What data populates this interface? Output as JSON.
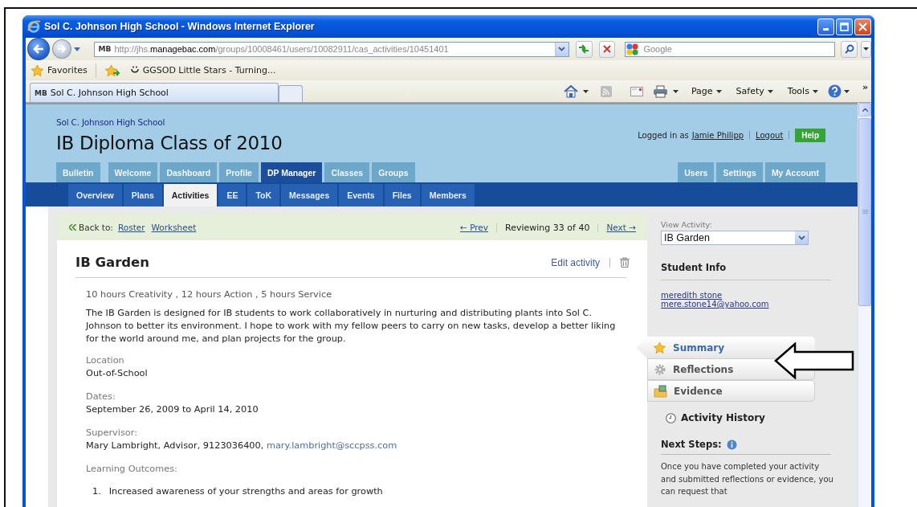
{
  "window": {
    "title": "Sol C. Johnson High School - Windows Internet Explorer"
  },
  "address_bar": {
    "site_icon": "MB",
    "url": "http://jhs.**managebac.com**/groups/10008461/users/10082911/cas_activities/10451401"
  },
  "search_box": {
    "placeholder": "Google"
  },
  "favorites_bar": {
    "label": "Favorites",
    "links": [
      {
        "label": "GGSOD Little Stars - Turning..."
      }
    ]
  },
  "browser_tabs": [
    {
      "site_icon": "MB",
      "label": "Sol C. Johnson High School",
      "selected": true
    }
  ],
  "command_bar": {
    "menus": [
      "Page",
      "Safety",
      "Tools"
    ],
    "overflow": "»"
  },
  "site_header": {
    "school": "Sol C. Johnson High School",
    "title": "IB Diploma Class of 2010",
    "login_label": "Logged in as",
    "user": "Jamie Philipp",
    "logout": "Logout",
    "help": "Help"
  },
  "main_tabs": [
    {
      "label": "Bulletin",
      "selected": false
    },
    {
      "label": "Welcome",
      "selected": false
    },
    {
      "label": "Dashboard",
      "selected": false
    },
    {
      "label": "Profile",
      "selected": false
    },
    {
      "label": "DP Manager",
      "selected": true
    },
    {
      "label": "Classes",
      "selected": false
    },
    {
      "label": "Groups",
      "selected": false
    }
  ],
  "account_tabs": [
    {
      "label": "Users",
      "selected": false
    },
    {
      "label": "Settings",
      "selected": false
    },
    {
      "label": "My Account",
      "selected": false
    }
  ],
  "sub_tabs": [
    {
      "label": "Overview",
      "selected": false
    },
    {
      "label": "Plans",
      "selected": false
    },
    {
      "label": "Activities",
      "selected": true
    },
    {
      "label": "EE",
      "selected": false
    },
    {
      "label": "ToK",
      "selected": false
    },
    {
      "label": "Messages",
      "selected": false
    },
    {
      "label": "Events",
      "selected": false
    },
    {
      "label": "Files",
      "selected": false
    },
    {
      "label": "Members",
      "selected": false
    }
  ],
  "review_bar": {
    "back_label": "Back to:",
    "links": [
      "Roster",
      "Worksheet"
    ],
    "prev": "← Prev",
    "status": "Reviewing 33 of 40",
    "next": "Next →"
  },
  "activity": {
    "title": "IB Garden",
    "edit": "Edit activity",
    "hours": "10 hours Creativity , 12 hours Action , 5 hours Service",
    "description": "The IB Garden is designed for IB students to work collaboratively in nurturing and distributing plants into Sol C. Johnson to better its environment. I hope to work with my fellow peers to carry on new tasks, develop a better liking for the world around me, and plan projects for the group.",
    "fields": [
      {
        "label": "Location",
        "value": "Out-of-School"
      },
      {
        "label": "Dates:",
        "value": "September 26, 2009 to April 14, 2010"
      },
      {
        "label": "Supervisor:",
        "value": "Mary Lambright, Advisor, 9123036400,",
        "link": "mary.lambright@sccpss.com"
      }
    ],
    "outcomes_label": "Learning Outcomes:",
    "outcomes": [
      {
        "number": "1.",
        "text": "Increased awareness of your strengths and areas for growth"
      }
    ]
  },
  "sidebar": {
    "view_label": "View Activity:",
    "selected_activity": "IB Garden",
    "student_info_title": "Student Info",
    "student_name": "meredith stone",
    "student_email": "mere.stone14@yahoo.com",
    "views": [
      {
        "label": "Summary",
        "kind": "star",
        "selected": true
      },
      {
        "label": "Reflections",
        "kind": "gear",
        "selected": false
      },
      {
        "label": "Evidence",
        "kind": "folder",
        "selected": false
      }
    ],
    "history": "Activity History",
    "next_steps_title": "Next Steps:",
    "next_steps_text": "Once you have completed your activity and submitted reflections or evidence, you can request that"
  }
}
